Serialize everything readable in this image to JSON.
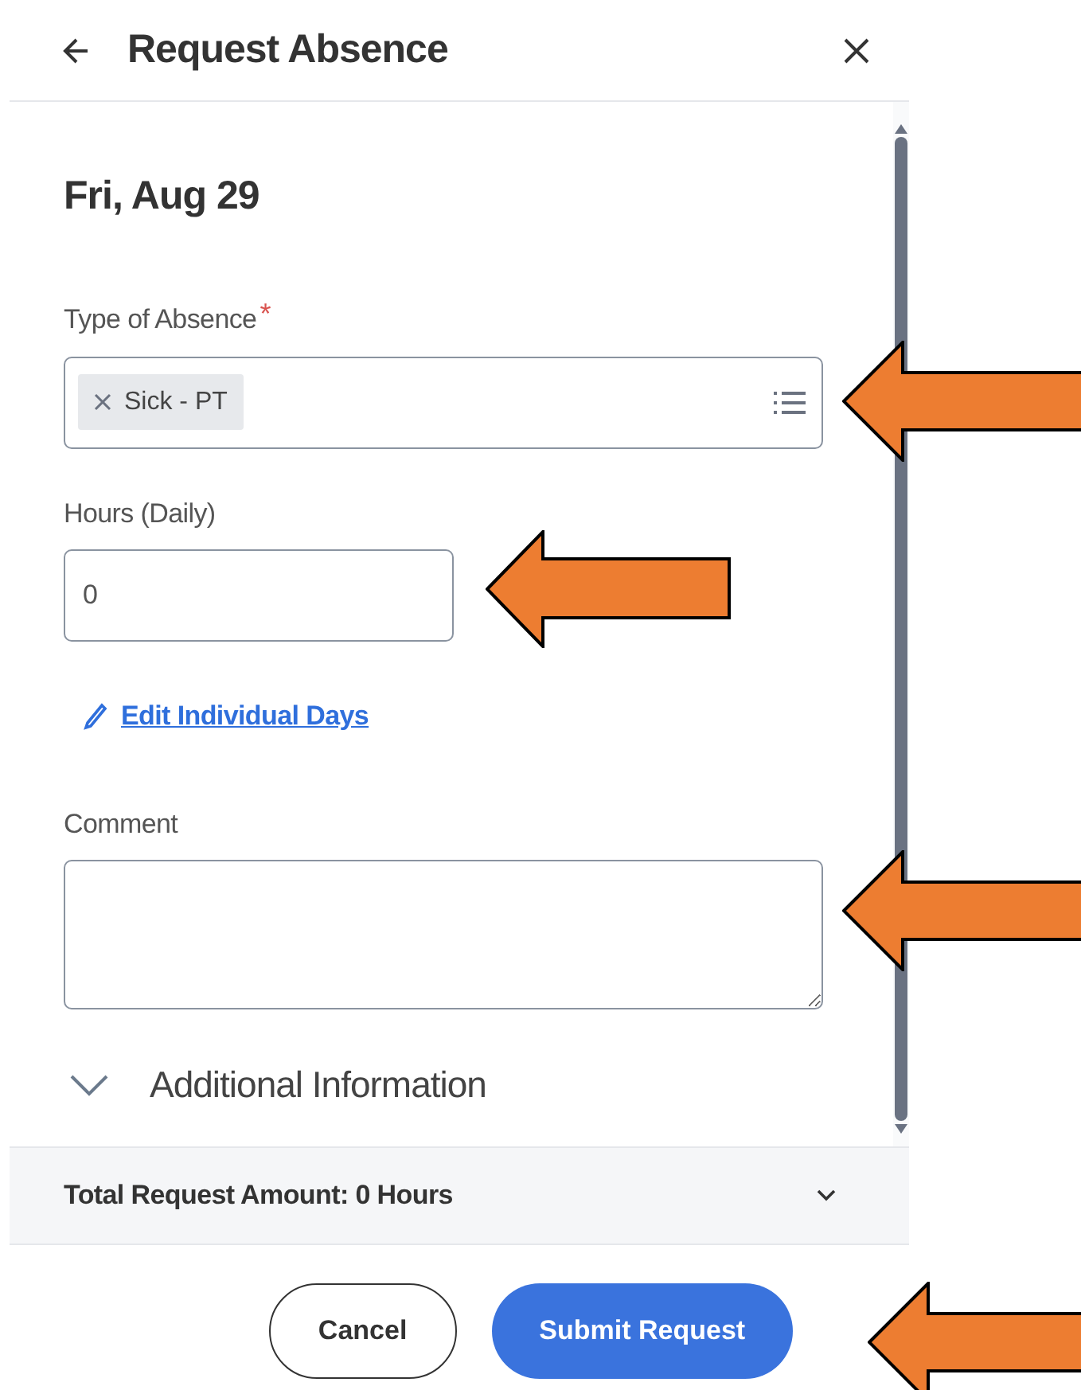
{
  "header": {
    "title": "Request Absence"
  },
  "date": "Fri, Aug 29",
  "fields": [
    {
      "kind": "multiselect",
      "label": "Type of Absence",
      "required_mark": "*",
      "tokens": [
        "Sick - PT"
      ]
    },
    {
      "kind": "text",
      "label": "Hours (Daily)",
      "value": "0"
    }
  ],
  "edit_link": "Edit Individual Days",
  "comment": {
    "label": "Comment"
  },
  "additional": {
    "label": "Additional Information",
    "expanded": false
  },
  "total": {
    "label": "Total Request Amount: 0 Hours",
    "expanded": false
  },
  "buttons": [
    {
      "label": "Cancel",
      "kind": "secondary"
    },
    {
      "label": "Submit Request",
      "kind": "primary"
    }
  ]
}
